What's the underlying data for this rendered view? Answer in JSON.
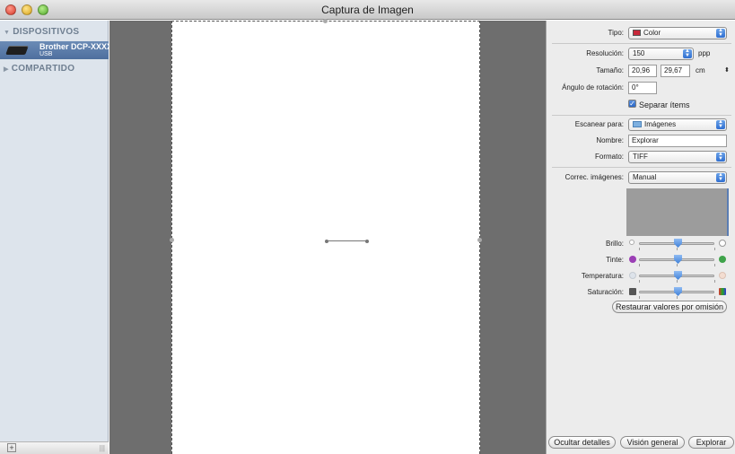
{
  "window": {
    "title": "Captura de Imagen"
  },
  "sidebar": {
    "devices_header": "DISPOSITIVOS",
    "device": {
      "name": "Brother  DCP-XXXX",
      "connection": "USB"
    },
    "shared_header": "COMPARTIDO"
  },
  "settings": {
    "tipo": {
      "label": "Tipo:",
      "value": "Color"
    },
    "resolucion": {
      "label": "Resolución:",
      "value": "150",
      "unit": "ppp"
    },
    "tamano": {
      "label": "Tamaño:",
      "width": "20,96",
      "height": "29,67",
      "unit": "cm"
    },
    "angulo": {
      "label": "Ángulo de rotación:",
      "value": "0°"
    },
    "separar": {
      "label": "Separar ítems",
      "checked": true
    },
    "escanear_para": {
      "label": "Escanear para:",
      "value": "Imágenes"
    },
    "nombre": {
      "label": "Nombre:",
      "value": "Explorar"
    },
    "formato": {
      "label": "Formato:",
      "value": "TIFF"
    },
    "correc": {
      "label": "Correc. imágenes:",
      "value": "Manual"
    },
    "sliders": [
      {
        "label": "Brillo:",
        "value": 0.5,
        "left_icon": "sun-small-icon",
        "right_icon": "sun-large-icon"
      },
      {
        "label": "Tinte:",
        "value": 0.5,
        "left_icon": "magenta-icon",
        "right_icon": "green-icon"
      },
      {
        "label": "Temperatura:",
        "value": 0.5,
        "left_icon": "cool-icon",
        "right_icon": "warm-icon"
      },
      {
        "label": "Saturación:",
        "value": 0.5,
        "left_icon": "grayscale-icon",
        "right_icon": "color-icon"
      }
    ],
    "restore_button": "Restaurar valores por omisión"
  },
  "footer": {
    "hide_details": "Ocultar detalles",
    "overview": "Visión general",
    "scan": "Explorar"
  },
  "colors": {
    "selection": "#5673a3",
    "preview_bg": "#6e6e6e",
    "accent": "#2f6fd1"
  }
}
